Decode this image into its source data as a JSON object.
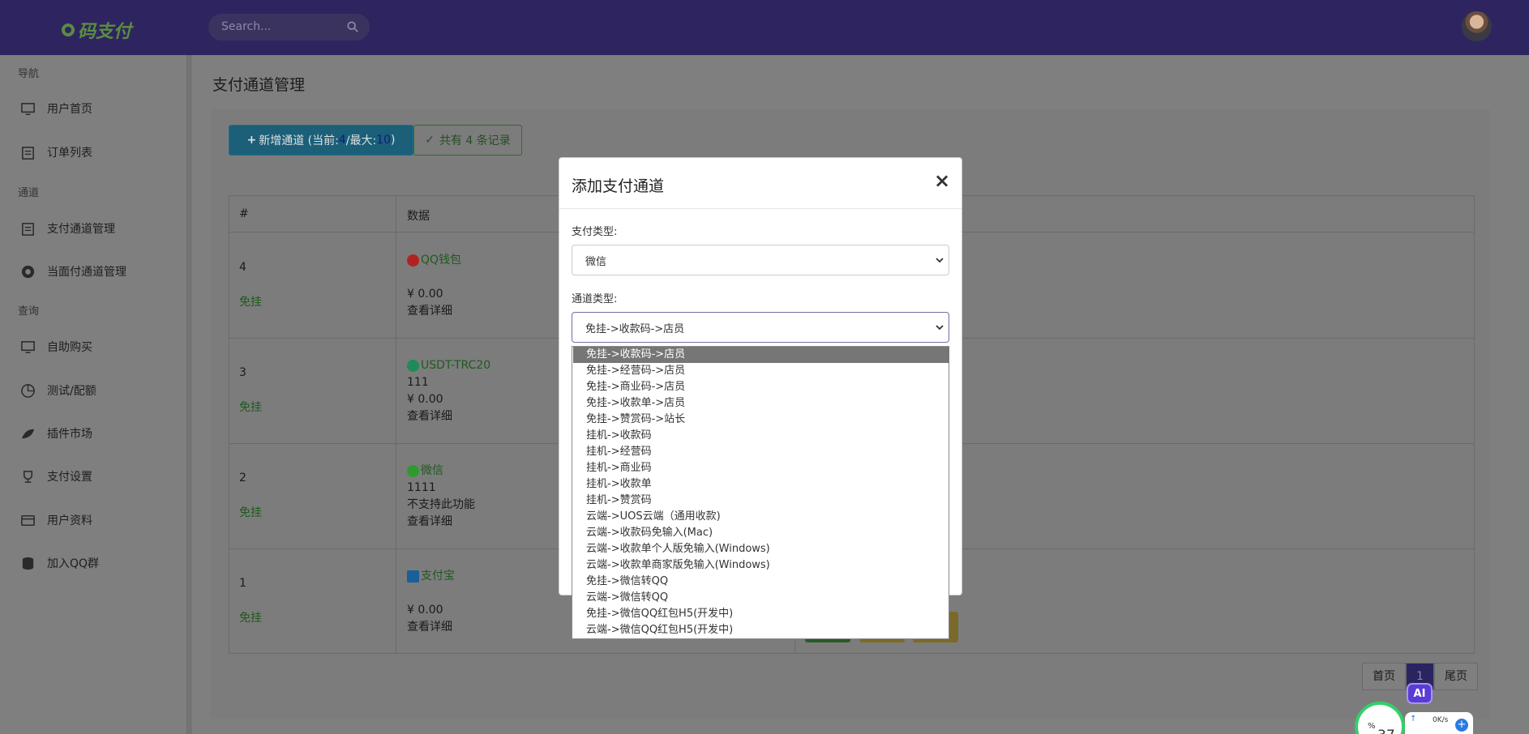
{
  "header": {
    "logo_text": "码支付",
    "search_placeholder": "Search..."
  },
  "sidebar": {
    "sections": [
      {
        "label": "导航",
        "items": [
          "用户首页",
          "订单列表"
        ]
      },
      {
        "label": "通道",
        "items": [
          "支付通道管理",
          "当面付通道管理"
        ]
      },
      {
        "label": "查询",
        "items": [
          "自助购买",
          "测试/配额",
          "插件市场",
          "支付设置",
          "用户资料",
          "加入QQ群"
        ]
      }
    ]
  },
  "page": {
    "title": "支付通道管理",
    "add_button": {
      "prefix": "新增通道 (当前: ",
      "current": "4",
      "middle": "/最大: ",
      "max": "10",
      "suffix": ")"
    },
    "record_count": "共有 4 条记录",
    "table": {
      "headers": [
        "#",
        "数据"
      ],
      "rows": [
        {
          "id": "4",
          "status": "免挂",
          "pay_name": "QQ钱包",
          "note": "",
          "amount": "¥ 0.00",
          "detail": "查看详细",
          "icon_color": "#b22222"
        },
        {
          "id": "3",
          "status": "免挂",
          "pay_name": "USDT-TRC20",
          "note": "111",
          "amount": "¥ 0.00",
          "detail": "查看详细",
          "icon_color": "#1f8a5a"
        },
        {
          "id": "2",
          "status": "免挂",
          "pay_name": "微信",
          "note": "1111",
          "amount": "不支持此功能",
          "detail": "查看详细",
          "icon_color": "#2e9a2e"
        },
        {
          "id": "1",
          "status": "免挂",
          "pay_name": "支付宝",
          "note": "",
          "amount": "¥ 0.00",
          "detail": "查看详细",
          "icon_color": "#1a5e9c"
        }
      ]
    },
    "pagination": {
      "first": "首页",
      "current": "1",
      "last": "尾页"
    }
  },
  "modal": {
    "title": "添加支付通道",
    "close": "×",
    "pay_type_label": "支付类型:",
    "pay_type_value": "微信",
    "channel_type_label": "通道类型:",
    "channel_type_value": "免挂->收款码->店员",
    "channel_options": [
      "免挂->收款码->店员",
      "免挂->经营码->店员",
      "免挂->商业码->店员",
      "免挂->收款单->店员",
      "免挂->赞赏码->站长",
      "挂机->收款码",
      "挂机->经营码",
      "挂机->商业码",
      "挂机->收款单",
      "挂机->赞赏码",
      "云端->UOS云端（通用收款)",
      "云端->收款码免输入(Mac)",
      "云端->收款单个人版免输入(Windows)",
      "云端->收款单商家版免输入(Windows)",
      "免挂->微信转QQ",
      "云端->微信转QQ",
      "免挂->微信QQ红包H5(开发中)",
      "云端->微信QQ红包H5(开发中)"
    ]
  },
  "widgets": {
    "ai_label": "AI",
    "cpu_percent": "37",
    "cpu_unit": "%",
    "net_speed": "0K/s"
  },
  "colors": {
    "header_bg": "#2e2560",
    "brand_green": "#5b8b42",
    "overlay_gray": "#7f7f7f"
  }
}
